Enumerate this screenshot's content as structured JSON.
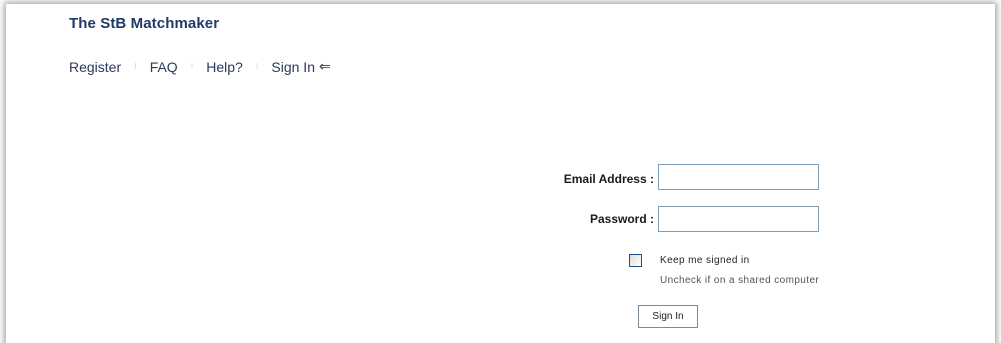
{
  "site": {
    "title": "The StB Matchmaker"
  },
  "nav": {
    "items": [
      {
        "label": "Register"
      },
      {
        "label": "FAQ"
      },
      {
        "label": "Help?"
      },
      {
        "label": "Sign In"
      }
    ],
    "separator": "⁝",
    "active_arrow": "⇐"
  },
  "login_form": {
    "email_label": "Email Address :",
    "email_value": "",
    "password_label": "Password :",
    "password_value": "",
    "keep_signed_in_label": "Keep me signed in",
    "keep_signed_in_checked": false,
    "keep_signed_in_hint": "Uncheck if on a shared computer",
    "submit_label": "Sign In"
  },
  "colors": {
    "title": "#1f3a68",
    "nav_text": "#2a3a5c",
    "input_border": "#7f9db9"
  }
}
